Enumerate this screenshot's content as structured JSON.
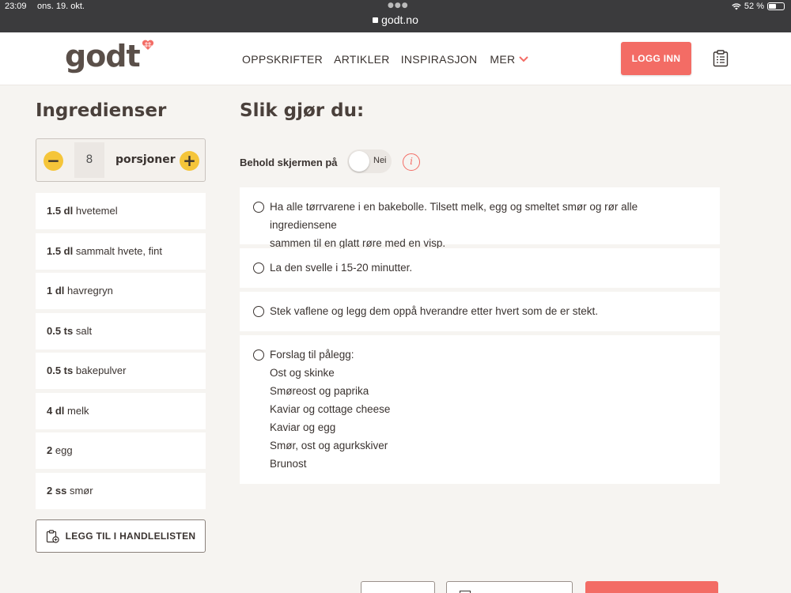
{
  "status_bar": {
    "time": "23:09",
    "date": "ons. 19. okt.",
    "url": "godt.no",
    "battery": "52 %",
    "battery_level": 0.52
  },
  "header": {
    "logo": "godt",
    "nav": [
      "OPPSKRIFTER",
      "ARTIKLER",
      "INSPIRASJON",
      "MER"
    ],
    "login_label": "LOGG INN",
    "accent_color": "#f36c65"
  },
  "ingredients": {
    "title": "Ingredienser",
    "portions_count": "8",
    "portions_label": "porsjoner",
    "items": [
      {
        "amount": "1.5 dl",
        "name": "hvetemel"
      },
      {
        "amount": "1.5 dl",
        "name": "sammalt hvete, fint"
      },
      {
        "amount": "1 dl",
        "name": "havregryn"
      },
      {
        "amount": "0.5 ts",
        "name": "salt"
      },
      {
        "amount": "0.5 ts",
        "name": "bakepulver"
      },
      {
        "amount": "4 dl",
        "name": "melk"
      },
      {
        "amount": "2",
        "name": "egg"
      },
      {
        "amount": "2 ss",
        "name": "smør"
      }
    ],
    "add_to_list_label": "LEGG TIL I HANDLELISTEN"
  },
  "steps": {
    "title": "Slik gjør du:",
    "keep_screen_label": "Behold skjermen på",
    "toggle_label": "Nei",
    "items": [
      [
        "Ha alle tørrvarene i en bakebolle. Tilsett melk, egg og smeltet smør og rør alle ingrediensene",
        "sammen til en glatt røre med en visp."
      ],
      [
        "La den svelle i 15-20 minutter."
      ],
      [
        "Stek vaflene og legg dem oppå hverandre etter hvert som de er stekt."
      ],
      [
        "Forslag til pålegg:",
        "Ost og skinke",
        "Smøreost og paprika",
        "Kaviar og cottage cheese",
        "Kaviar og egg",
        "Smør, ost og agurkskiver",
        "Brunost"
      ]
    ]
  }
}
